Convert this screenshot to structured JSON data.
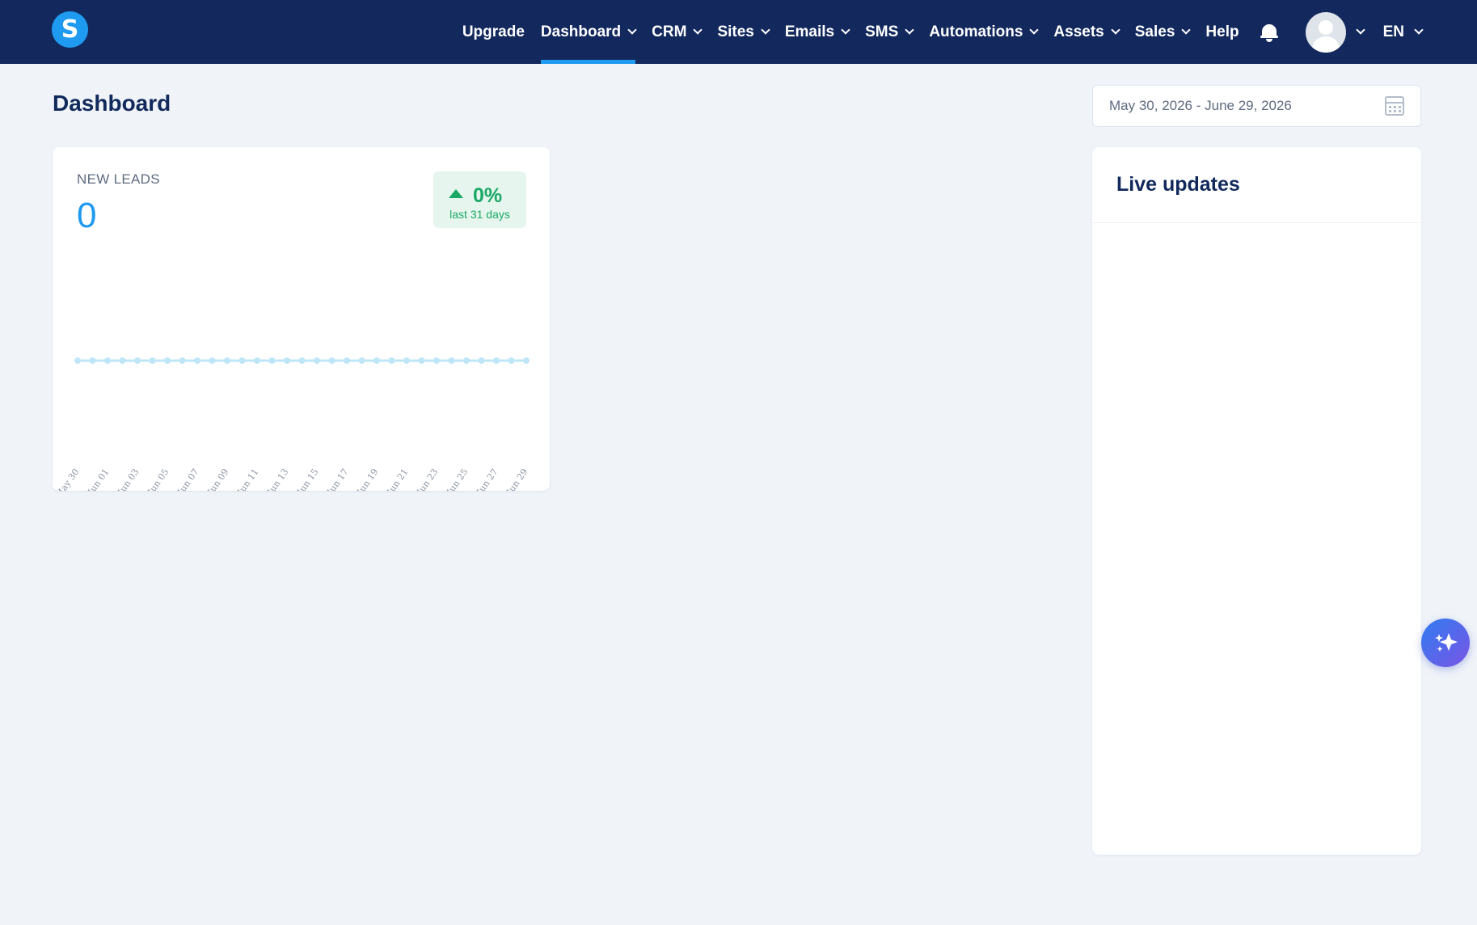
{
  "brand": {
    "logo_letter": "S"
  },
  "nav": {
    "items": [
      {
        "label": "Upgrade",
        "dropdown": false,
        "active": false
      },
      {
        "label": "Dashboard",
        "dropdown": true,
        "active": true
      },
      {
        "label": "CRM",
        "dropdown": true,
        "active": false
      },
      {
        "label": "Sites",
        "dropdown": true,
        "active": false
      },
      {
        "label": "Emails",
        "dropdown": true,
        "active": false
      },
      {
        "label": "SMS",
        "dropdown": true,
        "active": false
      },
      {
        "label": "Automations",
        "dropdown": true,
        "active": false
      },
      {
        "label": "Assets",
        "dropdown": true,
        "active": false
      },
      {
        "label": "Sales",
        "dropdown": true,
        "active": false
      },
      {
        "label": "Help",
        "dropdown": false,
        "active": false
      }
    ],
    "language": "EN"
  },
  "page": {
    "title": "Dashboard",
    "date_range": "May 30, 2026 - June 29, 2026"
  },
  "leads_card": {
    "label": "NEW LEADS",
    "value": "0",
    "change": "0%",
    "change_period": "last 31 days"
  },
  "live_updates": {
    "title": "Live updates"
  },
  "colors": {
    "nav_bg": "#13295d",
    "accent": "#1e9af0",
    "positive": "#1aa866",
    "page_bg": "#f0f4f9"
  },
  "icons": [
    "notification-bell-icon",
    "calendar-icon",
    "chevron-down-icon",
    "sparkle-icon",
    "user-avatar-icon"
  ],
  "chart_data": {
    "type": "line",
    "title": "",
    "xlabel": "",
    "ylabel": "",
    "categories": [
      "May 30",
      "May 31",
      "Jun 01",
      "Jun 02",
      "Jun 03",
      "Jun 04",
      "Jun 05",
      "Jun 06",
      "Jun 07",
      "Jun 08",
      "Jun 09",
      "Jun 10",
      "Jun 11",
      "Jun 12",
      "Jun 13",
      "Jun 14",
      "Jun 15",
      "Jun 16",
      "Jun 17",
      "Jun 18",
      "Jun 19",
      "Jun 20",
      "Jun 21",
      "Jun 22",
      "Jun 23",
      "Jun 24",
      "Jun 25",
      "Jun 26",
      "Jun 27",
      "Jun 28",
      "Jun 29"
    ],
    "tick_labels": [
      "May 30",
      "Jun 01",
      "Jun 03",
      "Jun 05",
      "Jun 07",
      "Jun 09",
      "Jun 11",
      "Jun 13",
      "Jun 15",
      "Jun 17",
      "Jun 19",
      "Jun 21",
      "Jun 23",
      "Jun 25",
      "Jun 27",
      "Jun 29"
    ],
    "values": [
      0,
      0,
      0,
      0,
      0,
      0,
      0,
      0,
      0,
      0,
      0,
      0,
      0,
      0,
      0,
      0,
      0,
      0,
      0,
      0,
      0,
      0,
      0,
      0,
      0,
      0,
      0,
      0,
      0,
      0,
      0
    ],
    "grid": false,
    "legend": "none",
    "line_color": "#bfe6f8"
  }
}
